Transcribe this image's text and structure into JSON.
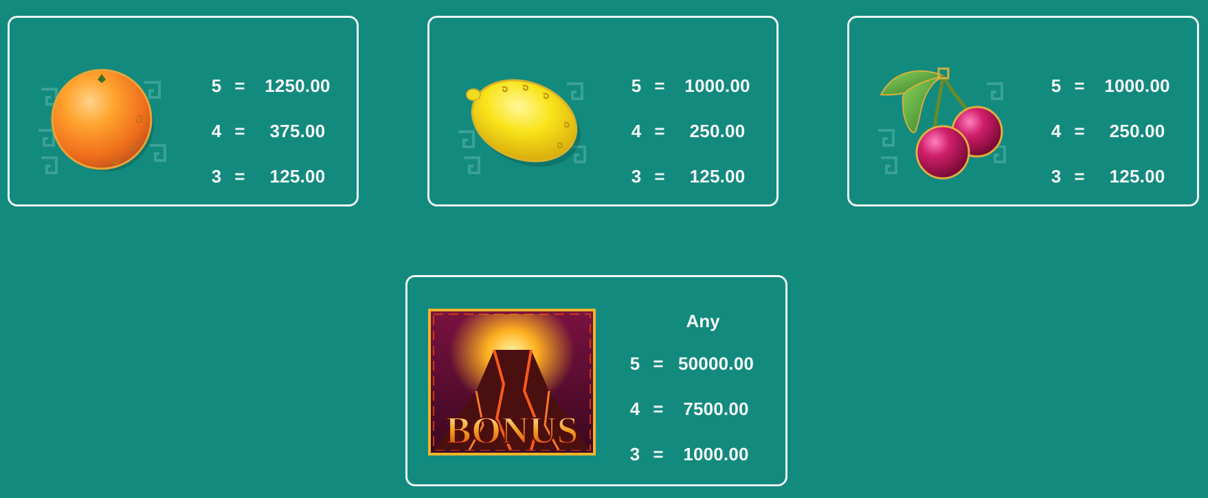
{
  "colors": {
    "background": "#138a7e",
    "border": "#eef5f3",
    "text": "#f4f7f6"
  },
  "cards": [
    {
      "symbol_icon": "orange-icon",
      "pays": [
        {
          "count": "5",
          "value": "1250.00"
        },
        {
          "count": "4",
          "value": "375.00"
        },
        {
          "count": "3",
          "value": "125.00"
        }
      ]
    },
    {
      "symbol_icon": "lemon-icon",
      "pays": [
        {
          "count": "5",
          "value": "1000.00"
        },
        {
          "count": "4",
          "value": "250.00"
        },
        {
          "count": "3",
          "value": "125.00"
        }
      ]
    },
    {
      "symbol_icon": "cherry-icon",
      "pays": [
        {
          "count": "5",
          "value": "1000.00"
        },
        {
          "count": "4",
          "value": "250.00"
        },
        {
          "count": "3",
          "value": "125.00"
        }
      ]
    }
  ],
  "bonus": {
    "symbol_icon": "bonus-volcano-icon",
    "symbol_text": "BONUS",
    "qualifier": "Any",
    "pays": [
      {
        "count": "5",
        "value": "50000.00"
      },
      {
        "count": "4",
        "value": "7500.00"
      },
      {
        "count": "3",
        "value": "1000.00"
      }
    ]
  },
  "equals_sign": "="
}
